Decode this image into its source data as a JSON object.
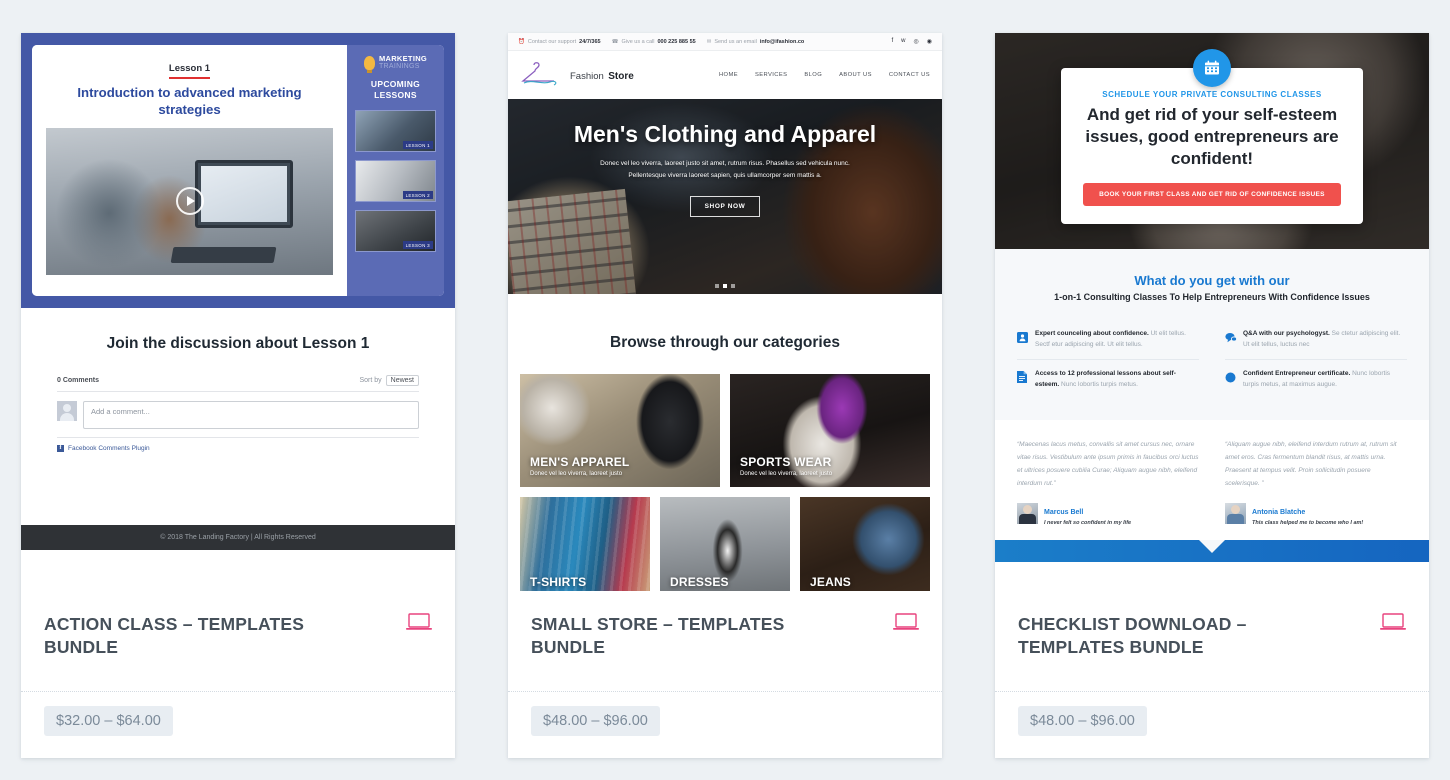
{
  "page": {
    "background": "#edf1f4",
    "accent_pink": "#e8437e",
    "accent_blue": "#1979d0"
  },
  "products": [
    {
      "title": "ACTION CLASS – TEMPLATES BUNDLE",
      "price": "$32.00 – $64.00",
      "icon": "laptop-icon"
    },
    {
      "title": "SMALL STORE – TEMPLATES BUNDLE",
      "price": "$48.00 – $96.00",
      "icon": "laptop-icon"
    },
    {
      "title": "CHECKLIST DOWNLOAD – TEMPLATES BUNDLE",
      "price": "$48.00 – $96.00",
      "icon": "laptop-icon"
    }
  ],
  "preview1": {
    "lesson_label": "Lesson 1",
    "heading": "Introduction to advanced marketing strategies",
    "play_button": "play-icon",
    "sidebar": {
      "brand_top": "MARKETING",
      "brand_bottom": "TRAININGS",
      "upcoming": "UPCOMING LESSONS",
      "thumbs": [
        {
          "tag": "LESSON 1"
        },
        {
          "tag": "LESSON 2"
        },
        {
          "tag": "LESSON 3"
        }
      ]
    },
    "discussion_heading": "Join the discussion about Lesson 1",
    "comments": {
      "count_label": "0 Comments",
      "sort_label": "Sort by",
      "sort_value": "Newest",
      "input_placeholder": "Add a comment...",
      "plugin_label": "Facebook Comments Plugin"
    },
    "footer": "© 2018 The Landing Factory | All Rights Reserved"
  },
  "preview2": {
    "topbar": {
      "support_label": "Contact our support",
      "support_value": "24/7/365",
      "call_label": "Give us a call",
      "call_value": "000 225 885 55",
      "email_label": "Send us an email",
      "email_value": "info@ifashion.co",
      "social": [
        "facebook-icon",
        "twitter-icon",
        "instagram-icon",
        "google-plus-icon"
      ]
    },
    "logo": {
      "line1": "Fashion",
      "line2": "Store",
      "mark": "hanger-icon"
    },
    "nav": [
      "HOME",
      "SERVICES",
      "BLOG",
      "ABOUT US",
      "CONTACT US"
    ],
    "hero": {
      "title": "Men's Clothing and Apparel",
      "text": "Donec vel leo viverra, laoreet justo sit amet, rutrum risus. Phasellus sed vehicula nunc. Pellentesque viverra laoreet sapien, quis ullamcorper sem mattis a.",
      "cta": "SHOP NOW",
      "slides": 3,
      "active_slide": 1
    },
    "categories_heading": "Browse through our categories",
    "categories": [
      {
        "name": "MEN'S APPAREL",
        "sub": "Donec vel leo viverra, laoreet justo",
        "size": "big"
      },
      {
        "name": "SPORTS WEAR",
        "sub": "Donec vel leo viverra, laoreet justo",
        "size": "big"
      },
      {
        "name": "T-SHIRTS",
        "sub": "",
        "size": "small"
      },
      {
        "name": "DRESSES",
        "sub": "",
        "size": "small"
      },
      {
        "name": "JEANS",
        "sub": "",
        "size": "small"
      }
    ]
  },
  "preview3": {
    "hero": {
      "badge_icon": "calendar-icon",
      "eyebrow": "SCHEDULE YOUR PRIVATE CONSULTING CLASSES",
      "heading": "And get rid of your self-esteem issues, good entrepreneurs are confident!",
      "cta": "BOOK YOUR FIRST CLASS AND GET RID OF CONFIDENCE ISSUES"
    },
    "features": {
      "heading": "What do you get with our",
      "subheading": "1-on-1 Consulting Classes To Help Entrepreneurs With Confidence Issues",
      "items": [
        {
          "icon": "person-icon",
          "bold": "Expert counceling about confidence.",
          "text": " Ut elit tellus. Sectf etur adipiscing elit. Ut elit tellus."
        },
        {
          "icon": "chat-icon",
          "bold": "Q&A with our psychologyst.",
          "text": " Se ctetur adipiscing elit. Ut elit tellus, luctus nec"
        },
        {
          "icon": "document-icon",
          "bold": "Access to 12 professional lessons about self-esteem.",
          "text": " Nunc lobortis turpis metus."
        },
        {
          "icon": "circle-icon",
          "bold": "Confident Entrepreneur certificate.",
          "text": " Nunc lobortis turpis metus, at maximus augue."
        }
      ]
    },
    "testimonials": [
      {
        "quote": "“Maecenas lacus metus, convallis sit amet cursus nec, ornare vitae risus. Vestibulum ante ipsum primis in faucibus orci luctus et ultrices posuere cubilia Curae; Aliquam augue nibh, eleifend interdum rut.”",
        "name": "Marcus Bell",
        "role": "I never felt so confident in my life",
        "avatar": "avatar-male"
      },
      {
        "quote": "“Aliquam augue nibh, eleifend interdum rutrum at, rutrum sit amet eros. Cras fermentum blandit risus, at mattis urna. Praesent at tempus velit. Proin sollicitudin posuere scelerisque. ”",
        "name": "Antonia Blatche",
        "role": "This class helped me to become who I am!",
        "avatar": "avatar-female"
      }
    ]
  }
}
